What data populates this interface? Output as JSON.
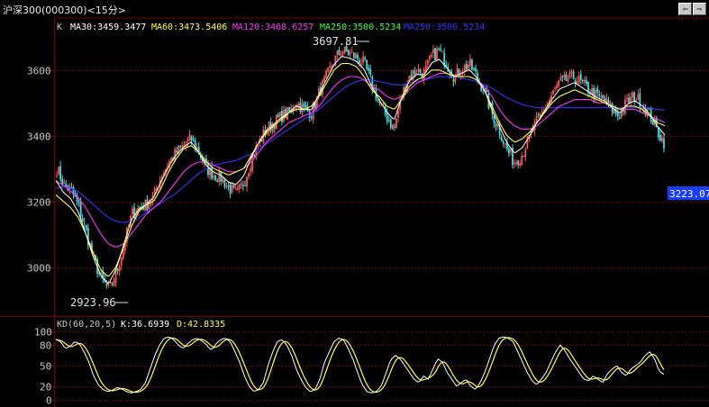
{
  "window": {
    "title": "沪深300(000300)<15分>",
    "buttons": [
      "⇦",
      "⇨",
      "×"
    ]
  },
  "colors": {
    "candle_up": "#ff5555",
    "candle_down": "#44dddd",
    "ma30": "#ffffff",
    "ma60": "#ffff33",
    "ma120": "#ff33ff",
    "ma250a": "#33ff33",
    "ma250b": "#3333ff",
    "grid": "#7a0000",
    "axis_text": "#c8c8c8",
    "k_line": "#ffffff",
    "d_line": "#ffff33",
    "last_price_bg": "#1a3cff"
  },
  "main_legend": {
    "k_label": "K",
    "ma30": "MA30:3459.3477",
    "ma60": "MA60:3473.5406",
    "ma120": "MA120:3468.6257",
    "ma250a": "MA250:3500.5234",
    "ma250b": "MA250:3500.5234"
  },
  "annotations": {
    "high": "3697.81",
    "low": "2923.96",
    "last_price": "3223.07"
  },
  "kd_legend": {
    "name": "KD(60,20,5)",
    "k": "K:36.6939",
    "d": "D:42.8335"
  },
  "chart_data": [
    {
      "type": "candlestick",
      "title": "沪深300(000300)<15分>",
      "ylim": [
        2900,
        3720
      ],
      "yticks": [
        3000,
        3200,
        3400,
        3600
      ],
      "high": 3697.81,
      "low": 2923.96,
      "last": 3223.07,
      "series": [
        {
          "name": "MA30",
          "value": 3459.3477
        },
        {
          "name": "MA60",
          "value": 3473.5406
        },
        {
          "name": "MA120",
          "value": 3468.6257
        },
        {
          "name": "MA250",
          "value": 3500.5234
        }
      ],
      "close_anchors": [
        3300,
        3250,
        3230,
        3180,
        3100,
        3020,
        2960,
        2930,
        2985,
        3070,
        3160,
        3180,
        3190,
        3220,
        3280,
        3320,
        3350,
        3370,
        3390,
        3350,
        3300,
        3280,
        3270,
        3240,
        3220,
        3260,
        3330,
        3380,
        3420,
        3440,
        3460,
        3470,
        3500,
        3480,
        3470,
        3530,
        3580,
        3630,
        3660,
        3650,
        3640,
        3620,
        3560,
        3500,
        3460,
        3420,
        3520,
        3580,
        3600,
        3590,
        3640,
        3660,
        3620,
        3580,
        3600,
        3620,
        3580,
        3540,
        3470,
        3420,
        3360,
        3320,
        3340,
        3390,
        3440,
        3480,
        3520,
        3560,
        3570,
        3580,
        3560,
        3540,
        3520,
        3510,
        3480,
        3460,
        3500,
        3520,
        3500,
        3470,
        3420,
        3380
      ],
      "ma_levels": {
        "ma_short": [
          3220,
          3200,
          3180,
          3150,
          3100,
          3040,
          2990,
          2970,
          3000,
          3060,
          3120,
          3170,
          3190,
          3200,
          3240,
          3290,
          3330,
          3360,
          3370,
          3350,
          3320,
          3300,
          3290,
          3280,
          3290,
          3300,
          3340,
          3380,
          3410,
          3430,
          3450,
          3470,
          3480,
          3480,
          3490,
          3520,
          3560,
          3600,
          3620,
          3620,
          3610,
          3580,
          3540,
          3520,
          3490,
          3480,
          3510,
          3550,
          3570,
          3580,
          3600,
          3600,
          3590,
          3580,
          3580,
          3580,
          3570,
          3540,
          3490,
          3440,
          3400,
          3380,
          3390,
          3410,
          3440,
          3470,
          3500,
          3520,
          3530,
          3540,
          3530,
          3520,
          3510,
          3500,
          3490,
          3480,
          3490,
          3490,
          3480,
          3460,
          3440,
          3430
        ],
        "ma_mid": [
          3260,
          3250,
          3230,
          3210,
          3180,
          3140,
          3100,
          3070,
          3060,
          3070,
          3100,
          3130,
          3160,
          3180,
          3200,
          3230,
          3260,
          3290,
          3310,
          3320,
          3320,
          3310,
          3300,
          3290,
          3290,
          3300,
          3320,
          3350,
          3380,
          3400,
          3420,
          3440,
          3450,
          3460,
          3470,
          3490,
          3520,
          3550,
          3570,
          3580,
          3580,
          3570,
          3550,
          3540,
          3520,
          3510,
          3520,
          3540,
          3560,
          3570,
          3580,
          3590,
          3590,
          3580,
          3580,
          3580,
          3570,
          3550,
          3520,
          3480,
          3450,
          3430,
          3420,
          3420,
          3430,
          3450,
          3470,
          3490,
          3500,
          3510,
          3510,
          3510,
          3500,
          3500,
          3490,
          3480,
          3480,
          3480,
          3470,
          3460,
          3450,
          3440
        ],
        "ma_long": [
          3240,
          3245,
          3240,
          3230,
          3210,
          3190,
          3170,
          3150,
          3140,
          3135,
          3140,
          3150,
          3165,
          3180,
          3195,
          3210,
          3225,
          3245,
          3265,
          3285,
          3300,
          3310,
          3315,
          3320,
          3325,
          3335,
          3345,
          3360,
          3375,
          3390,
          3405,
          3420,
          3435,
          3450,
          3465,
          3480,
          3500,
          3520,
          3540,
          3555,
          3565,
          3570,
          3570,
          3565,
          3560,
          3555,
          3555,
          3560,
          3565,
          3570,
          3575,
          3580,
          3580,
          3580,
          3575,
          3570,
          3565,
          3555,
          3545,
          3530,
          3515,
          3505,
          3495,
          3490,
          3485,
          3485,
          3485,
          3485,
          3485,
          3485,
          3485,
          3485,
          3485,
          3485,
          3485,
          3485,
          3485,
          3485,
          3485,
          3485,
          3480,
          3478
        ]
      }
    },
    {
      "type": "line",
      "title": "KD(60,20,5)",
      "ylim": [
        0,
        100
      ],
      "yticks": [
        0,
        20,
        50,
        80,
        100
      ],
      "series": [
        {
          "name": "K",
          "value": 36.6939
        },
        {
          "name": "D",
          "value": 42.8335
        }
      ],
      "k_values": [
        88,
        85,
        75,
        78,
        85,
        82,
        70,
        55,
        35,
        22,
        15,
        12,
        14,
        18,
        16,
        12,
        10,
        12,
        15,
        25,
        45,
        65,
        80,
        90,
        92,
        88,
        80,
        75,
        82,
        88,
        90,
        86,
        80,
        72,
        82,
        88,
        90,
        85,
        70,
        55,
        35,
        20,
        12,
        15,
        25,
        50,
        70,
        85,
        88,
        80,
        65,
        45,
        30,
        18,
        12,
        15,
        30,
        55,
        70,
        85,
        90,
        88,
        75,
        60,
        40,
        22,
        12,
        10,
        12,
        20,
        38,
        58,
        65,
        60,
        50,
        40,
        30,
        25,
        35,
        30,
        45,
        60,
        55,
        40,
        30,
        20,
        25,
        30,
        20,
        15,
        25,
        40,
        60,
        80,
        90,
        92,
        90,
        85,
        70,
        55,
        40,
        28,
        22,
        30,
        40,
        55,
        70,
        80,
        72,
        60,
        50,
        40,
        30,
        28,
        35,
        30,
        25,
        38,
        45,
        50,
        40,
        35,
        45,
        50,
        55,
        65,
        70,
        60,
        42,
        37
      ]
    }
  ]
}
